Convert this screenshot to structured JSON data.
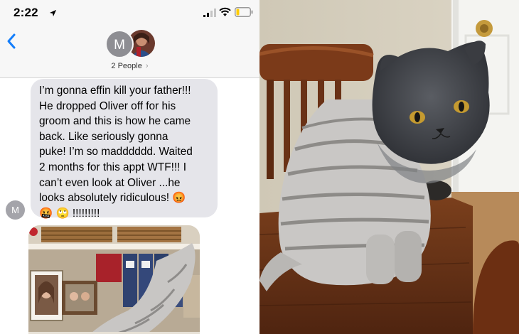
{
  "status_bar": {
    "time": "2:22",
    "icons": [
      "location-arrow-icon",
      "signal-icon",
      "wifi-icon",
      "battery-icon"
    ]
  },
  "header": {
    "avatar_initial": "M",
    "people_label": "2 People",
    "chevron": "›"
  },
  "conversation": {
    "message": "I’m gonna effin kill your father!!!\nHe dropped Oliver off for his\ngroom and this is how he came\nback. Like seriously gonna\npuke! I’m so madddddd. Waited\n2 months for this appt WTF!!! I\ncan’t even look at Oliver ...he\nlooks absolutely ridiculous! 😡\n🤬 🙄 !!!!!!!!!",
    "sender_initial": "M"
  },
  "colors": {
    "ios_blue": "#147efb",
    "bubble_gray": "#e5e5ea",
    "avatar_gray": "#8e8e93"
  }
}
